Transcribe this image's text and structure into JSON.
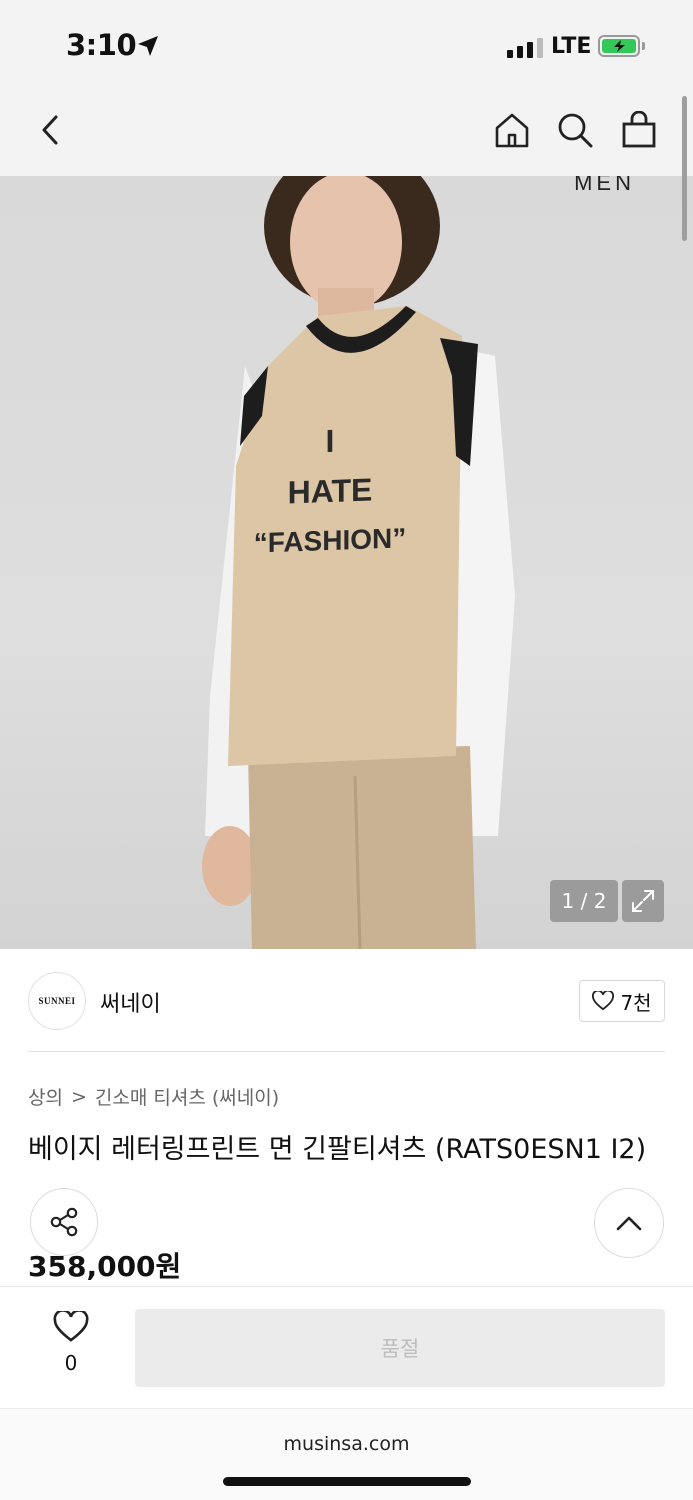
{
  "status_bar": {
    "time": "3:10",
    "network": "LTE"
  },
  "hero": {
    "brand_mark": "MEN",
    "counter": "1 / 2"
  },
  "brand": {
    "logo_text": "SUNNEI",
    "name": "써네이",
    "likes": "7천"
  },
  "breadcrumb": {
    "category": "상의",
    "separator": ">",
    "subcategory": "긴소매 티셔츠 (써네이)"
  },
  "product": {
    "title": "베이지 레터링프린트 면 긴팔티셔츠 (RATS0ESN1 I2)",
    "price": "358,000원",
    "garment_text_line1": "I",
    "garment_text_line2": "HATE",
    "garment_text_line3": "“FASHION”"
  },
  "purchase_bar": {
    "wish_count": "0",
    "soldout_label": "품절"
  },
  "browser": {
    "url": "musinsa.com"
  },
  "colors": {
    "soldout_bg": "#ebebeb",
    "battery": "#34c759",
    "vest": "#dcc6a6"
  }
}
